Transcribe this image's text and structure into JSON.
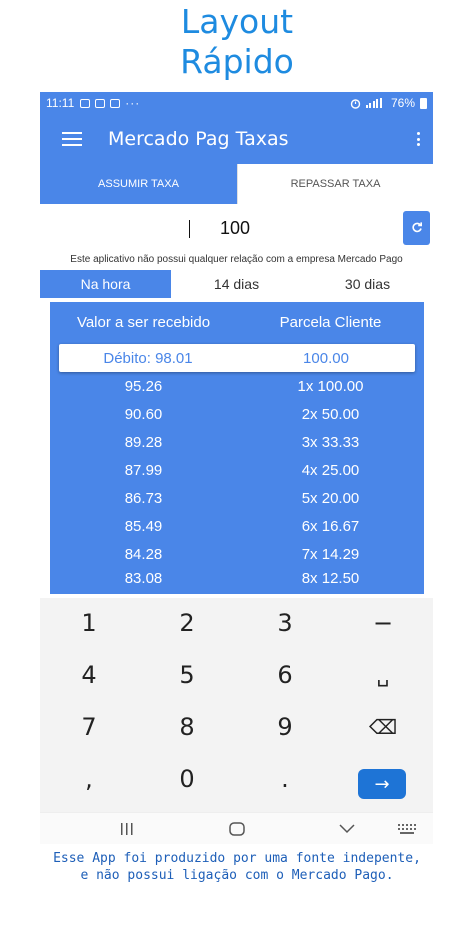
{
  "promo": {
    "line1": "Layout",
    "line2": "Rápido"
  },
  "statusbar": {
    "time": "11:11",
    "battery": "76%"
  },
  "appbar": {
    "title": "Mercado Pag Taxas"
  },
  "tabs": [
    {
      "label": "ASSUMIR TAXA",
      "active": true
    },
    {
      "label": "REPASSAR TAXA",
      "active": false
    }
  ],
  "amount": {
    "value": "100"
  },
  "disclaimer": "Este aplicativo não possui qualquer relação com a empresa Mercado Pago",
  "period_tabs": [
    {
      "label": "Na hora",
      "active": true
    },
    {
      "label": "14 dias",
      "active": false
    },
    {
      "label": "30 dias",
      "active": false
    }
  ],
  "table": {
    "headers": [
      "Valor a ser recebido",
      "Parcela Cliente"
    ],
    "rows": [
      {
        "valor": "Débito: 98.01",
        "parcela": "100.00"
      },
      {
        "valor": "95.26",
        "parcela": "1x 100.00"
      },
      {
        "valor": "90.60",
        "parcela": "2x 50.00"
      },
      {
        "valor": "89.28",
        "parcela": "3x 33.33"
      },
      {
        "valor": "87.99",
        "parcela": "4x 25.00"
      },
      {
        "valor": "86.73",
        "parcela": "5x 20.00"
      },
      {
        "valor": "85.49",
        "parcela": "6x 16.67"
      },
      {
        "valor": "84.28",
        "parcela": "7x 14.29"
      },
      {
        "valor": "83.08",
        "parcela": "8x 12.50"
      }
    ]
  },
  "keyboard": {
    "keys": [
      "1",
      "2",
      "3",
      "−",
      "4",
      "5",
      "6",
      "␣",
      "7",
      "8",
      "9",
      "⌫",
      ",",
      "0",
      ".",
      "→"
    ]
  },
  "footer": {
    "line1": "Esse App foi produzido por uma fonte indepente,",
    "line2": "e não possui ligação com o Mercado Pago."
  },
  "colors": {
    "primary": "#4a86e8",
    "promo_blue": "#1e8be0",
    "enter_blue": "#1e74d6"
  }
}
